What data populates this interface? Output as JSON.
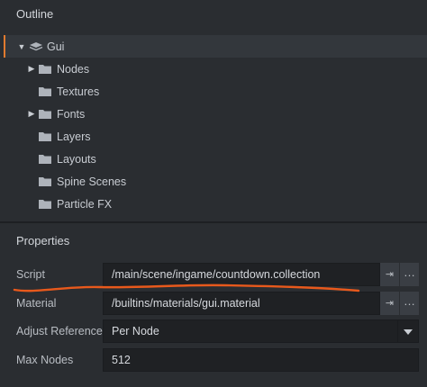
{
  "outline": {
    "title": "Outline",
    "root": {
      "label": "Gui",
      "expanded": true
    },
    "items": [
      {
        "label": "Nodes",
        "expandable": true
      },
      {
        "label": "Textures",
        "expandable": false
      },
      {
        "label": "Fonts",
        "expandable": true
      },
      {
        "label": "Layers",
        "expandable": false
      },
      {
        "label": "Layouts",
        "expandable": false
      },
      {
        "label": "Spine Scenes",
        "expandable": false
      },
      {
        "label": "Particle FX",
        "expandable": false
      }
    ]
  },
  "properties": {
    "title": "Properties",
    "script": {
      "label": "Script",
      "value": "/main/scene/ingame/countdown.collection"
    },
    "material": {
      "label": "Material",
      "value": "/builtins/materials/gui.material"
    },
    "adjust_reference": {
      "label": "Adjust Reference",
      "value": "Per Node"
    },
    "max_nodes": {
      "label": "Max Nodes",
      "value": "512"
    },
    "goto_glyph": "⇥",
    "more_glyph": "…"
  },
  "colors": {
    "accent": "#e07a2f",
    "annotation": "#e8591c"
  }
}
